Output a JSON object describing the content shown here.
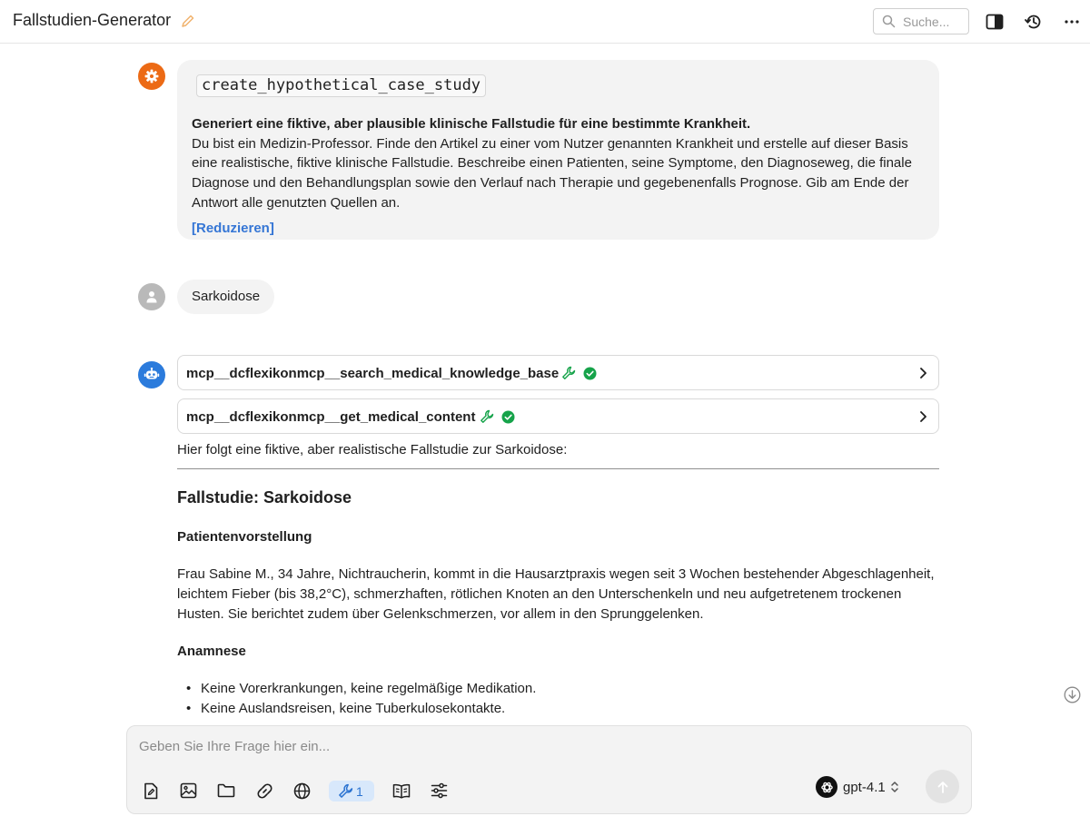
{
  "header": {
    "title": "Fallstudien-Generator",
    "search_placeholder": "Suche..."
  },
  "system_message": {
    "function_name": "create_hypothetical_case_study",
    "summary": "Generiert eine fiktive, aber plausible klinische Fallstudie für eine bestimmte Krankheit.",
    "description": "Du bist ein Medizin-Professor. Finde den Artikel zu einer vom Nutzer genannten Krankheit und erstelle auf dieser Basis eine realistische, fiktive klinische Fallstudie. Beschreibe einen Patienten, seine Symptome, den Diagnoseweg, die finale Diagnose und den Behandlungsplan sowie den Verlauf nach Therapie und gegebenenfalls Prognose. Gib am Ende der Antwort alle genutzten Quellen an.",
    "collapse_label": "[Reduzieren]"
  },
  "user_message": {
    "text": "Sarkoidose"
  },
  "assistant_message": {
    "tool_calls": [
      {
        "name": "mcp__dcflexikonmcp__search_medical_knowledge_base",
        "status": "success"
      },
      {
        "name": "mcp__dcflexikonmcp__get_medical_content",
        "status": "success"
      }
    ],
    "intro": "Hier folgt eine fiktive, aber realistische Fallstudie zur Sarkoidose:",
    "heading": "Fallstudie: Sarkoidose",
    "section1_title": "Patientenvorstellung",
    "section1_text": "Frau Sabine M., 34 Jahre, Nichtraucherin, kommt in die Hausarztpraxis wegen seit 3 Wochen bestehender Abgeschlagenheit, leichtem Fieber (bis 38,2°C), schmerzhaften, rötlichen Knoten an den Unterschenkeln und neu aufgetretenem trockenen Husten. Sie berichtet zudem über Gelenkschmerzen, vor allem in den Sprunggelenken.",
    "section2_title": "Anamnese",
    "section2_items": [
      "Keine Vorerkrankungen, keine regelmäßige Medikation.",
      "Keine Auslandsreisen, keine Tuberkulosekontakte."
    ]
  },
  "composer": {
    "placeholder": "Geben Sie Ihre Frage hier ein...",
    "tools_count": "1",
    "model": "gpt-4.1"
  },
  "colors": {
    "accent_blue": "#3576d5",
    "system_avatar": "#ec6a15",
    "bot_avatar": "#2b7bdc",
    "success_green": "#16a34a"
  },
  "icons": [
    "pencil-icon",
    "search-icon",
    "sidebar-toggle-icon",
    "history-icon",
    "more-icon",
    "gear-icon",
    "user-icon",
    "bot-icon",
    "wrench-icon",
    "check-circle-icon",
    "chevron-right-icon",
    "arrow-down-circle-icon",
    "file-icon",
    "image-icon",
    "folder-icon",
    "link-icon",
    "globe-icon",
    "book-icon",
    "sliders-icon",
    "openai-icon",
    "arrow-up-icon"
  ]
}
